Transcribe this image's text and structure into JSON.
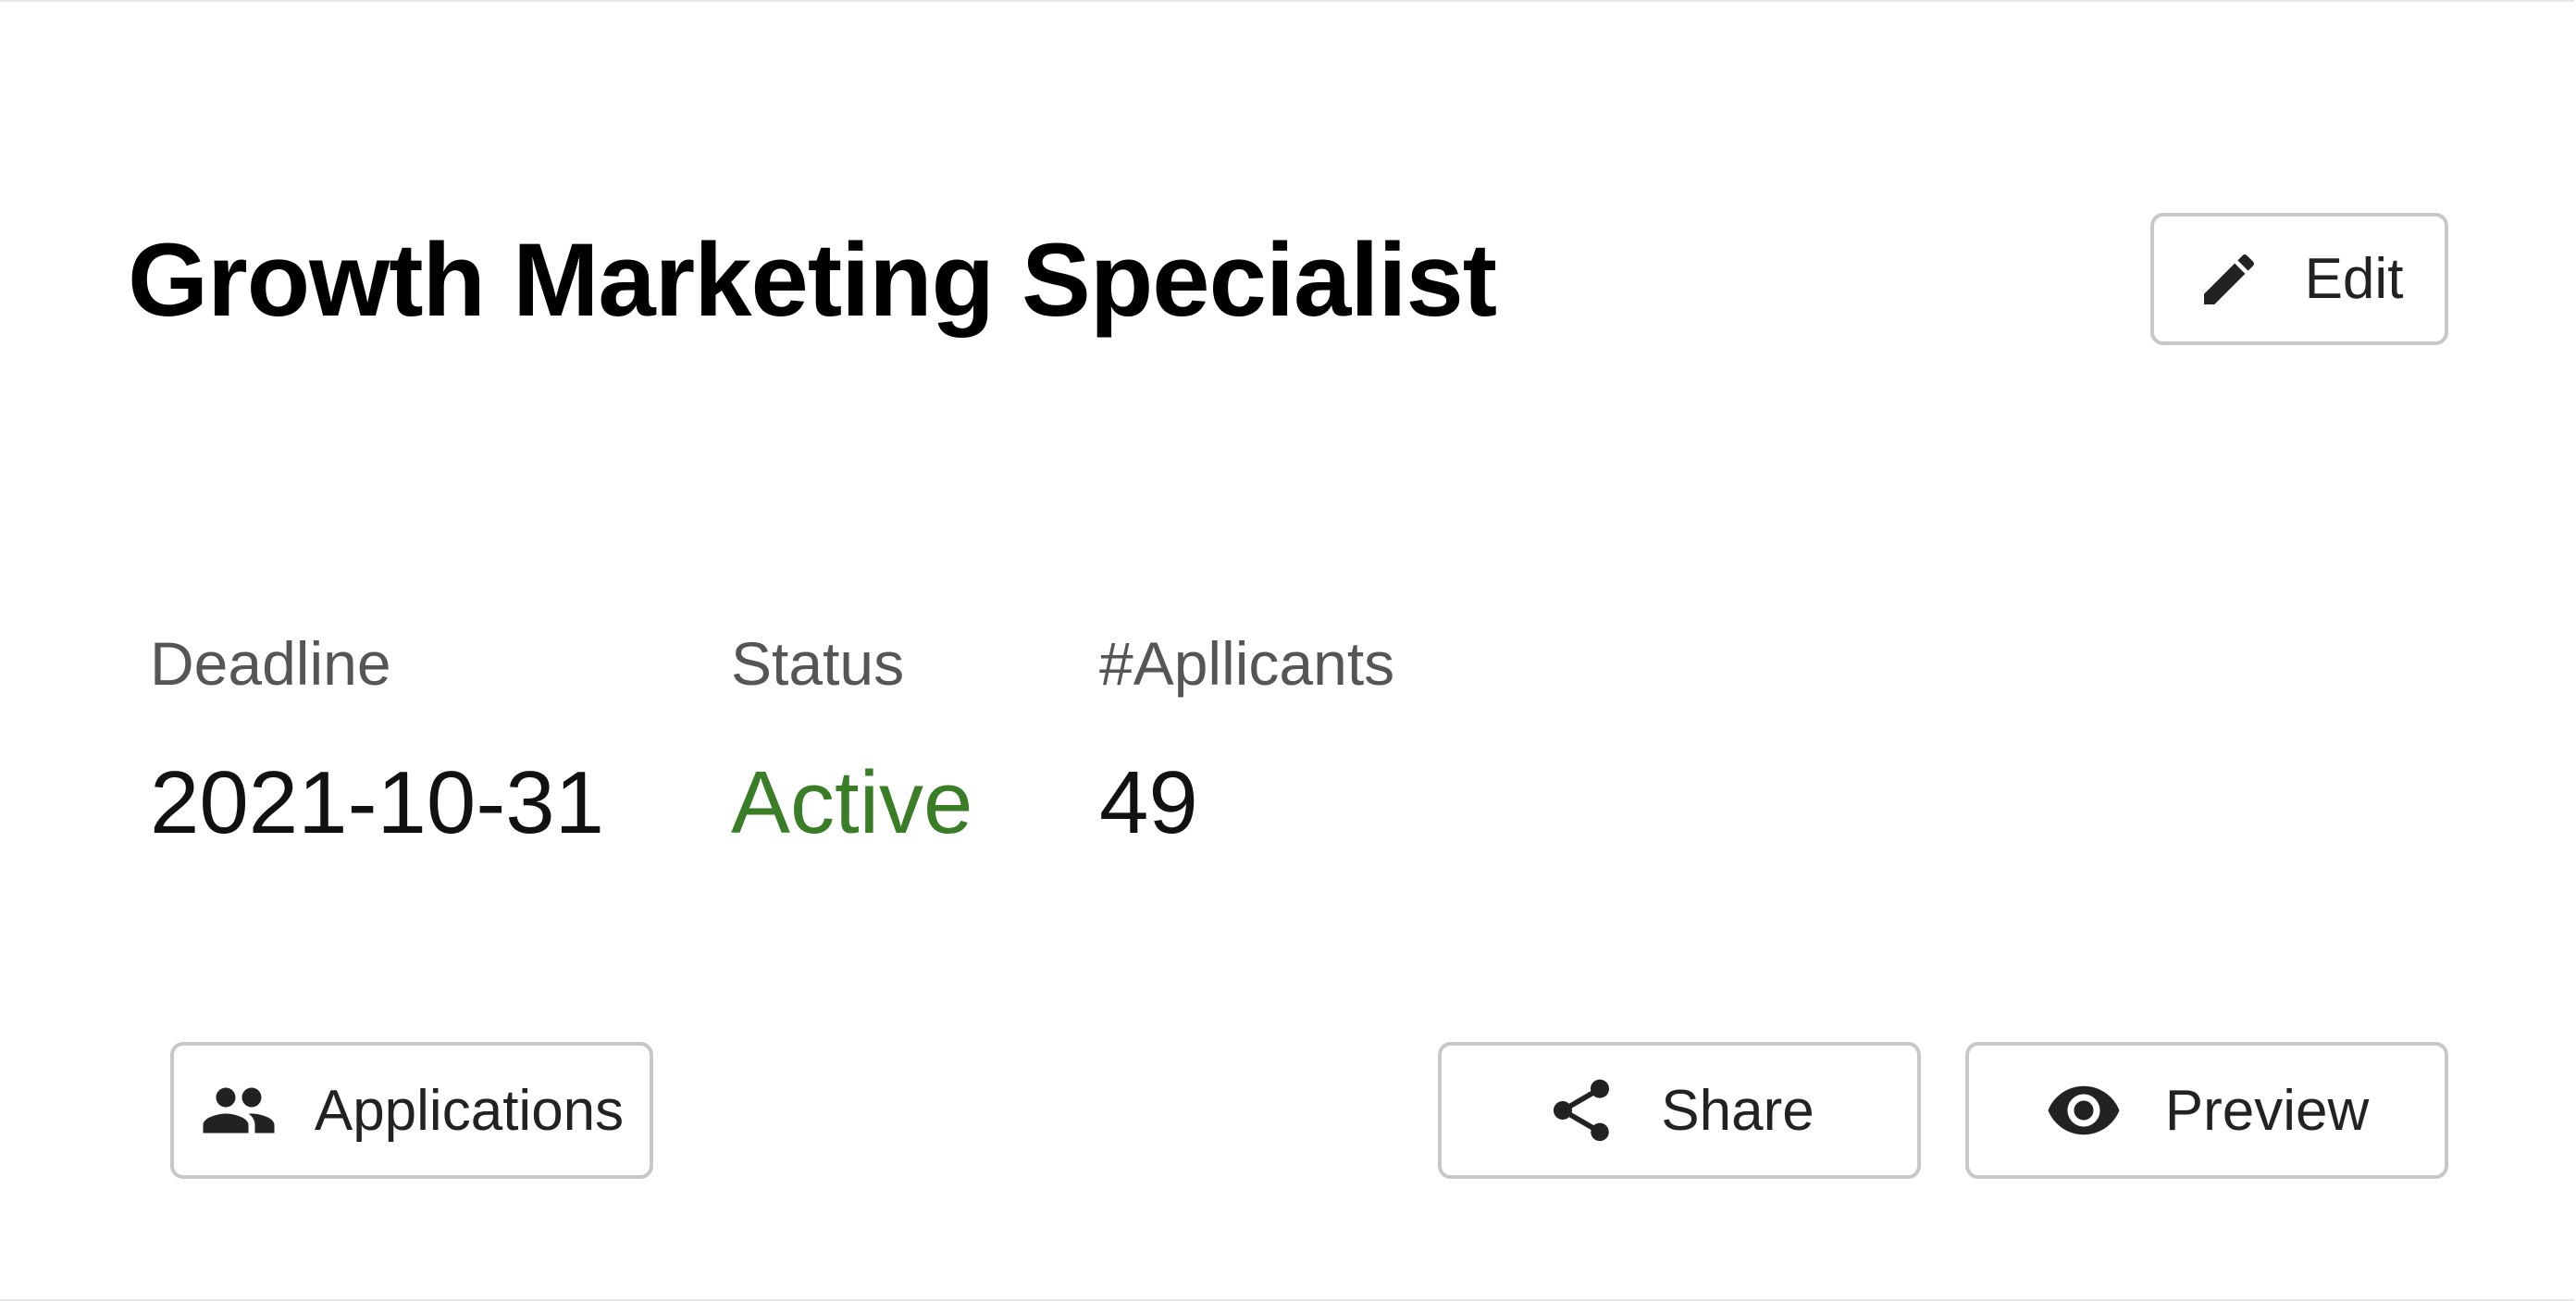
{
  "job": {
    "title": "Growth Marketing Specialist"
  },
  "actions": {
    "edit_label": "Edit",
    "applications_label": "Applications",
    "share_label": "Share",
    "preview_label": "Preview"
  },
  "stats": {
    "deadline": {
      "label": "Deadline",
      "value": "2021-10-31"
    },
    "status": {
      "label": "Status",
      "value": "Active",
      "color": "#3a7d27"
    },
    "applicants": {
      "label": "#Apllicants",
      "value": "49"
    }
  },
  "icons": {
    "edit": "pencil-icon",
    "applications": "people-icon",
    "share": "share-icon",
    "preview": "eye-icon"
  }
}
